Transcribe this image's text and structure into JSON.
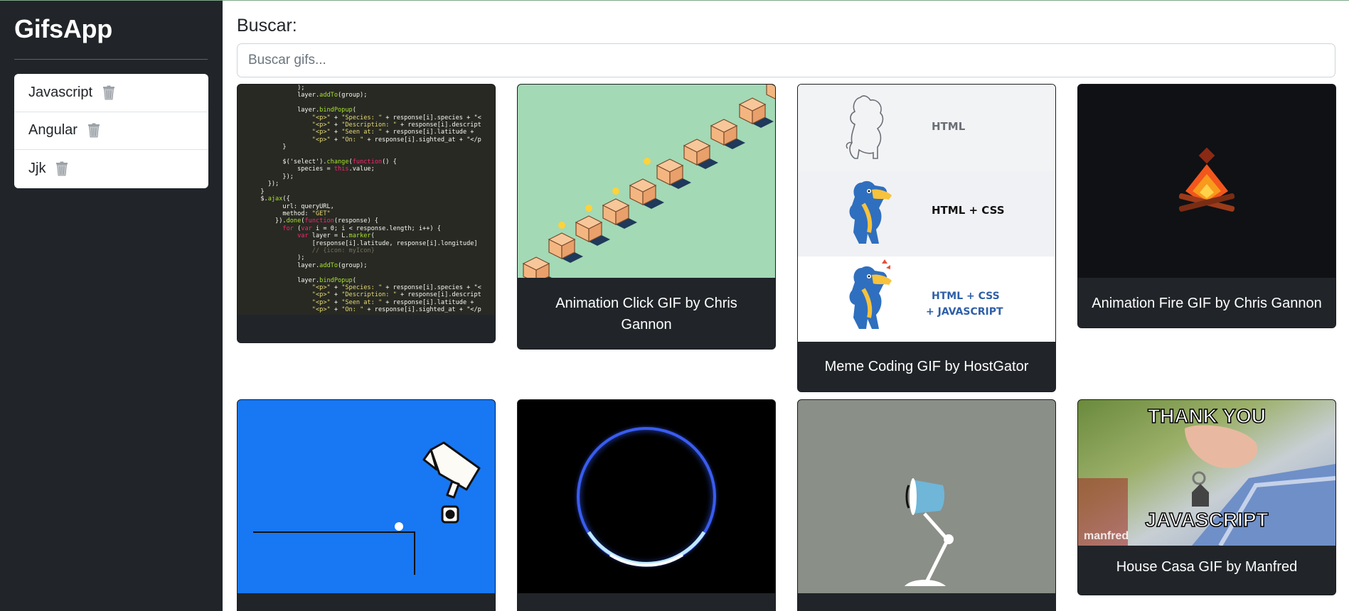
{
  "app": {
    "title": "GifsApp"
  },
  "sidebar": {
    "history": [
      {
        "label": "Javascript",
        "icon": "trash-icon"
      },
      {
        "label": "Angular",
        "icon": "trash-icon"
      },
      {
        "label": "Jjk",
        "icon": "trash-icon"
      }
    ]
  },
  "search": {
    "label": "Buscar:",
    "placeholder": "Buscar gifs...",
    "value": ""
  },
  "gifs": [
    {
      "title": "",
      "image": "code-editor-screenshot"
    },
    {
      "title": "Animation Click GIF by Chris Gannon",
      "image": "isometric-boxes-ducks"
    },
    {
      "title": "Meme Coding GIF by HostGator",
      "image": "hostgator-html-css-javascript"
    },
    {
      "title": "Animation Fire GIF by Chris Gannon",
      "image": "campfire"
    },
    {
      "title": "",
      "image": "security-camera-blue"
    },
    {
      "title": "",
      "image": "glowing-ring"
    },
    {
      "title": "",
      "image": "desk-lamp"
    },
    {
      "title": "House Casa GIF by Manfred",
      "image": "thank-you-javascript-house-key"
    }
  ],
  "gif_text": {
    "hg_html": "HTML",
    "hg_html_css": "HTML + CSS",
    "hg_html_css_js_1": "HTML + CSS",
    "hg_html_css_js_2": "+ JAVASCRIPT",
    "meme_top": "THANK YOU",
    "meme_bottom": "JAVASCRIPT",
    "meme_watermark": "manfred"
  },
  "code_lines": [
    "            );",
    "            layer.addTo(group);",
    "",
    "            layer.bindPopup(",
    "                \"<p>\" + \"Species: \" + response[i].species + \"<",
    "                \"<p>\" + \"Description: \" + response[i].descript",
    "                \"<p>\" + \"Seen at: \" + response[i].latitude +",
    "                \"<p>\" + \"On: \" + response[i].sighted_at + \"</p",
    "        }",
    "",
    "        $('select').change(function() {",
    "            species = this.value;",
    "        });",
    "    });",
    "  }",
    "  $.ajax({",
    "        url: queryURL,",
    "        method: \"GET\"",
    "      }).done(function(response) {",
    "        for (var i = 0; i < response.length; i++) {",
    "            var layer = L.marker(",
    "                [response[i].latitude, response[i].longitude]",
    "                // {icon: myIcon}",
    "            );",
    "            layer.addTo(group);",
    "",
    "            layer.bindPopup(",
    "                \"<p>\" + \"Species: \" + response[i].species + \"<",
    "                \"<p>\" + \"Description: \" + response[i].descript",
    "                \"<p>\" + \"Seen at: \" + response[i].latitude +",
    "                \"<p>\" + \"On: \" + response[i].sighted_at + \"</p"
  ],
  "colors": {
    "sidebar_bg": "#212529",
    "card_bg": "#212529",
    "boxes_bg": "#a3d9b5",
    "camera_bg": "#1877f2",
    "lamp_bg": "#8a8f88",
    "fire_bg": "#0f1115"
  }
}
